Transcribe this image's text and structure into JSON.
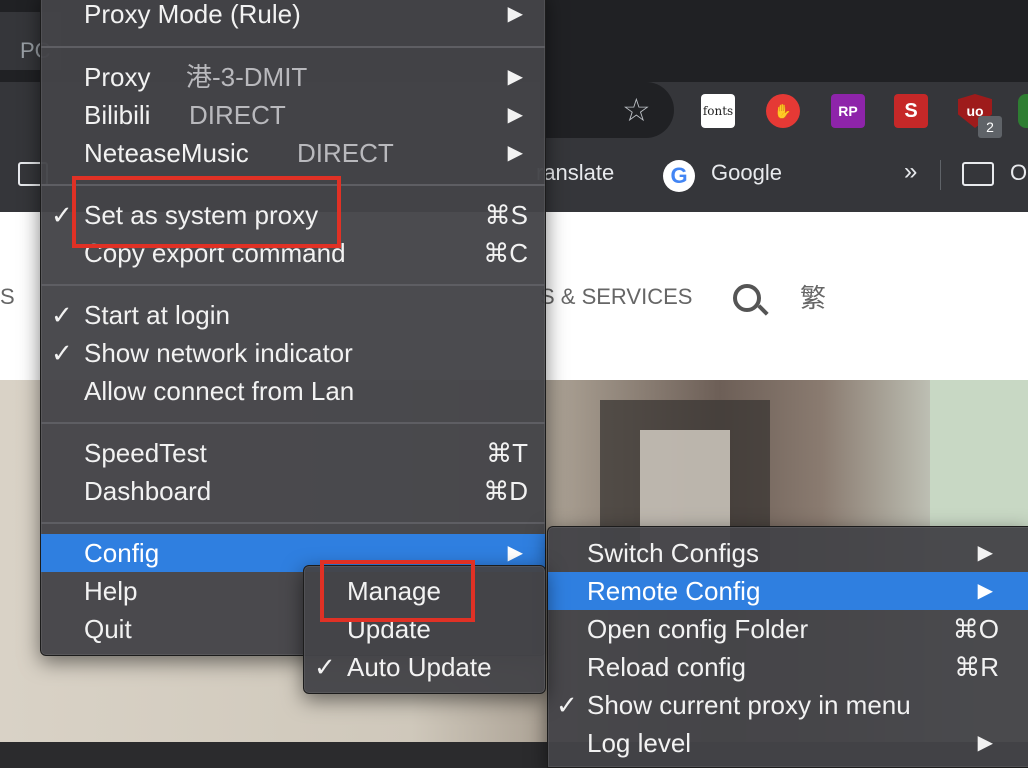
{
  "browser": {
    "tab_title": "PC",
    "bookmarks": {
      "translate": "ranslate",
      "google": "Google",
      "more": "»",
      "other": "O"
    },
    "extensions": {
      "fonts_label": "fonts",
      "rp_label": "RP",
      "s_label": "S",
      "ublock_label": "uo",
      "ublock_badge": "2"
    }
  },
  "webpage": {
    "nav_left": "S",
    "nav_services": "S & SERVICES",
    "lang_toggle": "繁"
  },
  "main_menu": {
    "proxy_mode": "Proxy Mode (Rule)",
    "proxy": {
      "label": "Proxy",
      "value": "港-3-DMIT"
    },
    "bilibili": {
      "label": "Bilibili",
      "value": "DIRECT"
    },
    "netease": {
      "label": "NeteaseMusic",
      "value": "DIRECT"
    },
    "set_system_proxy": {
      "label": "Set as system proxy",
      "shortcut": "⌘S",
      "checked": true
    },
    "copy_export": {
      "label": "Copy export command",
      "shortcut": "⌘C"
    },
    "start_login": {
      "label": "Start at login",
      "checked": true
    },
    "show_network": {
      "label": "Show network indicator",
      "checked": true
    },
    "allow_lan": {
      "label": "Allow connect from Lan"
    },
    "speedtest": {
      "label": "SpeedTest",
      "shortcut": "⌘T"
    },
    "dashboard": {
      "label": "Dashboard",
      "shortcut": "⌘D"
    },
    "config": {
      "label": "Config",
      "highlighted": true
    },
    "help": {
      "label": "Help"
    },
    "quit": {
      "label": "Quit"
    }
  },
  "config_submenu": {
    "switch_configs": "Switch Configs",
    "remote_config": "Remote Config",
    "open_folder": {
      "label": "Open config Folder",
      "shortcut": "⌘O"
    },
    "reload": {
      "label": "Reload config",
      "shortcut": "⌘R"
    },
    "show_proxy": {
      "label": "Show current proxy in menu",
      "checked": true
    },
    "log_level": "Log level"
  },
  "remote_submenu": {
    "manage": "Manage",
    "update": "Update",
    "auto_update": {
      "label": "Auto Update",
      "checked": true
    }
  },
  "glyphs": {
    "check": "✓",
    "arrow": "▶",
    "star": "☆"
  },
  "colors": {
    "highlight": "#2f7fe0",
    "annotation": "#e03125",
    "menu_bg": "#444448"
  }
}
